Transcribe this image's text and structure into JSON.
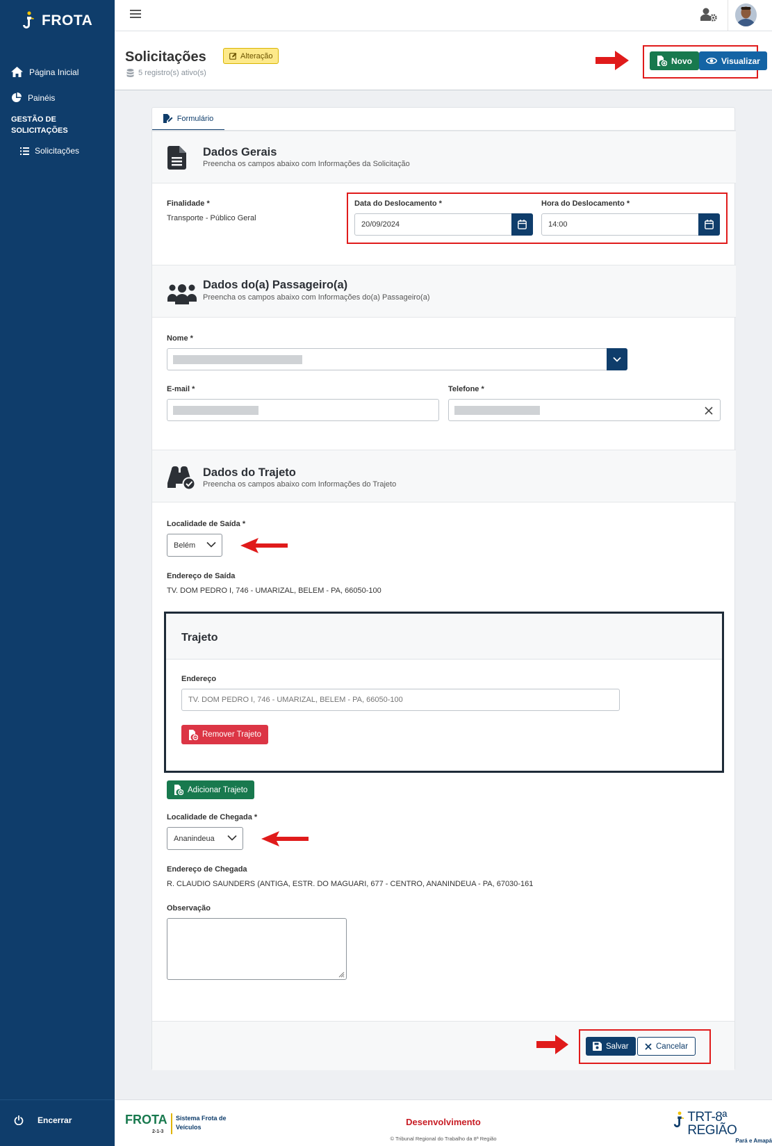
{
  "app": {
    "name": "FROTA"
  },
  "sidebar": {
    "items": [
      {
        "label": "Página Inicial",
        "icon": "home-icon"
      },
      {
        "label": "Painéis",
        "icon": "pie-chart-icon"
      }
    ],
    "section_label": "GESTÃO DE SOLICITAÇÕES",
    "sub_items": [
      {
        "label": "Solicitações",
        "icon": "list-icon"
      }
    ],
    "logout_label": "Encerrar"
  },
  "header": {
    "title": "Solicitações",
    "mode_badge": "Alteração",
    "records": "5 registro(s) ativo(s)",
    "new_label": "Novo",
    "view_label": "Visualizar"
  },
  "form": {
    "tab_label": "Formulário",
    "general": {
      "title": "Dados Gerais",
      "subtitle": "Preencha os campos abaixo com Informações da Solicitação",
      "purpose_label": "Finalidade *",
      "purpose_value": "Transporte - Público Geral",
      "date_label": "Data do Deslocamento *",
      "date_value": "20/09/2024",
      "time_label": "Hora do Deslocamento *",
      "time_value": "14:00"
    },
    "passenger": {
      "title": "Dados do(a) Passageiro(a)",
      "subtitle": "Preencha os campos abaixo com Informações do(a) Passageiro(a)",
      "name_label": "Nome *",
      "email_label": "E-mail *",
      "phone_label": "Telefone *"
    },
    "route": {
      "title": "Dados do Trajeto",
      "subtitle": "Preencha os campos abaixo com Informações do Trajeto",
      "departure_label": "Localidade de Saída *",
      "departure_value": "Belém",
      "departure_address_label": "Endereço de Saída",
      "departure_address": "TV. DOM PEDRO I, 746 - UMARIZAL, BELEM - PA, 66050-100",
      "trajeto_title": "Trajeto",
      "trajeto_address_label": "Endereço",
      "trajeto_address_placeholder": "TV. DOM PEDRO I, 746 - UMARIZAL, BELEM - PA, 66050-100",
      "remove_label": "Remover Trajeto",
      "add_label": "Adicionar Trajeto",
      "arrival_label": "Localidade de Chegada *",
      "arrival_value": "Ananindeua",
      "arrival_address_label": "Endereço de Chegada",
      "arrival_address": "R. CLAUDIO SAUNDERS (ANTIGA, ESTR. DO MAGUARI, 677 - CENTRO, ANANINDEUA - PA, 67030-161",
      "observation_label": "Observação"
    },
    "save_label": "Salvar",
    "cancel_label": "Cancelar"
  },
  "footer": {
    "brand": "FROTA",
    "version": "2-1-3",
    "system_name": "Sistema Frota de Veículos",
    "environment": "Desenvolvimento",
    "copyright": "© Tribunal Regional do Trabalho da 8ª Região",
    "org_name": "TRT-8ª REGIÃO",
    "org_sub": "Pará e Amapá"
  },
  "colors": {
    "primary": "#0f3d6b",
    "success": "#18794e",
    "info": "#1464a5",
    "danger": "#dc3545",
    "warning_badge": "#fde98a",
    "highlight": "#e01b1b"
  }
}
